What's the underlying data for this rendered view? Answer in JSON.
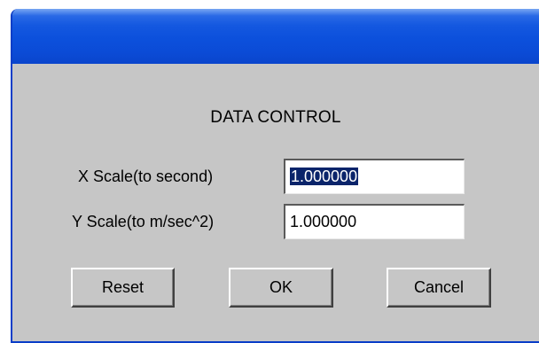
{
  "dialog": {
    "heading": "DATA CONTROL",
    "x_scale": {
      "label": "X Scale(to second)",
      "value": "1.000000",
      "selected": true
    },
    "y_scale": {
      "label": "Y Scale(to m/sec^2)",
      "value": "1.000000"
    },
    "buttons": {
      "reset": "Reset",
      "ok": "OK",
      "cancel": "Cancel"
    }
  },
  "colors": {
    "titlebar": "#0b4bd6",
    "dialog_bg": "#c6c6c6",
    "selection": "#0a246a"
  }
}
